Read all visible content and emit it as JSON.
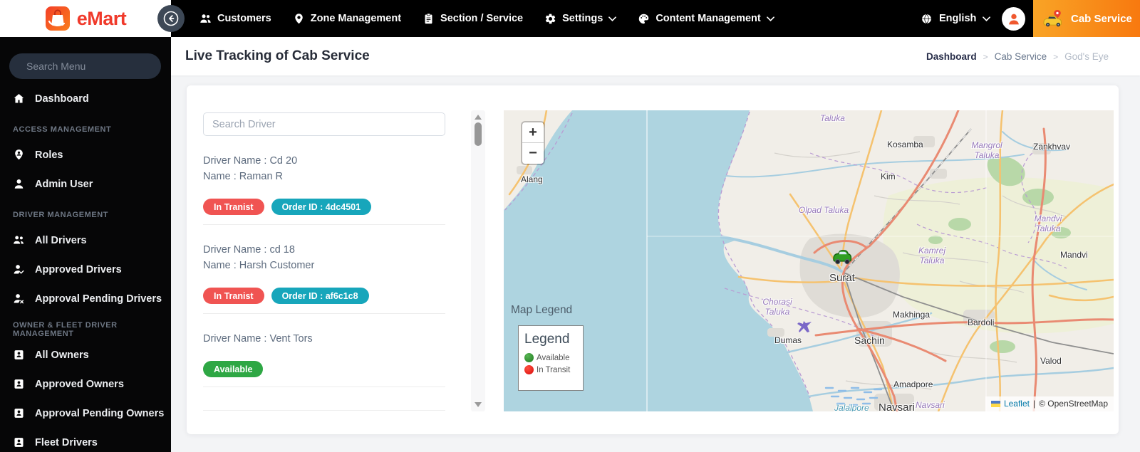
{
  "topbar": {
    "brand": "eMart",
    "items": [
      "Customers",
      "Zone Management",
      "Section / Service",
      "Settings",
      "Content Management"
    ],
    "language": "English",
    "service": "Cab Service"
  },
  "sidebar": {
    "search_placeholder": "Search Menu",
    "dashboard": "Dashboard",
    "headers": [
      "ACCESS MANAGEMENT",
      "DRIVER MANAGEMENT",
      "OWNER & FLEET DRIVER MANAGEMENT"
    ],
    "access_items": [
      "Roles",
      "Admin User"
    ],
    "driver_items": [
      "All Drivers",
      "Approved Drivers",
      "Approval Pending Drivers"
    ],
    "owner_items": [
      "All Owners",
      "Approved Owners",
      "Approval Pending Owners",
      "Fleet Drivers"
    ]
  },
  "page": {
    "title": "Live Tracking of Cab Service",
    "breadcrumb": [
      "Dashboard",
      "Cab Service",
      "God's Eye"
    ],
    "breadcrumb_sep": ">"
  },
  "drivers": {
    "search_placeholder": "Search Driver",
    "list": [
      {
        "driver_name": "Driver Name : Cd 20",
        "customer_name": "Name : Raman R",
        "status": "In Tranist",
        "order": "Order ID : 4dc4501"
      },
      {
        "driver_name": "Driver Name : cd 18",
        "customer_name": "Name : Harsh Customer",
        "status": "In Tranist",
        "order": "Order ID : af6c1c8"
      },
      {
        "driver_name": "Driver Name : Vent Tors",
        "status": "Available"
      }
    ]
  },
  "map": {
    "zoom_in": "+",
    "zoom_out": "−",
    "legend_heading": "Map Legend",
    "legend": {
      "title": "Legend",
      "items": [
        {
          "label": "Available",
          "color": "#2f9e2f"
        },
        {
          "label": "In Transit",
          "color": "#ee1111"
        }
      ]
    },
    "attribution": {
      "leaflet": "Leaflet",
      "sep": "|",
      "osm": "© OpenStreetMap"
    },
    "labels": [
      {
        "name": "Alang"
      },
      {
        "name": "Taluka"
      },
      {
        "name": "Kosamba"
      },
      {
        "name": "Zankhvav"
      },
      {
        "name": "Kim"
      },
      {
        "name": "Olpad Taluka"
      },
      {
        "name": "Mangrol Taluka"
      },
      {
        "name": "Mandvi Taluka"
      },
      {
        "name": "Kamrej Taluka"
      },
      {
        "name": "Mandvi"
      },
      {
        "name": "Surat"
      },
      {
        "name": "Makhinga"
      },
      {
        "name": "Chorasi Taluka"
      },
      {
        "name": "Dumas"
      },
      {
        "name": "Sachin"
      },
      {
        "name": "Bardoli"
      },
      {
        "name": "Amadpore"
      },
      {
        "name": "Valod"
      },
      {
        "name": "Navsari"
      },
      {
        "name": "Navsari"
      },
      {
        "name": "Jalalpore"
      }
    ]
  },
  "colors": {
    "brand_red": "#f03a2b",
    "topbar_orange": "#f8790f",
    "badge_red": "#f05452",
    "badge_teal": "#17a6bb",
    "badge_green": "#2ea744",
    "legend_green": "#2f9e2f",
    "legend_red": "#ee1111"
  }
}
